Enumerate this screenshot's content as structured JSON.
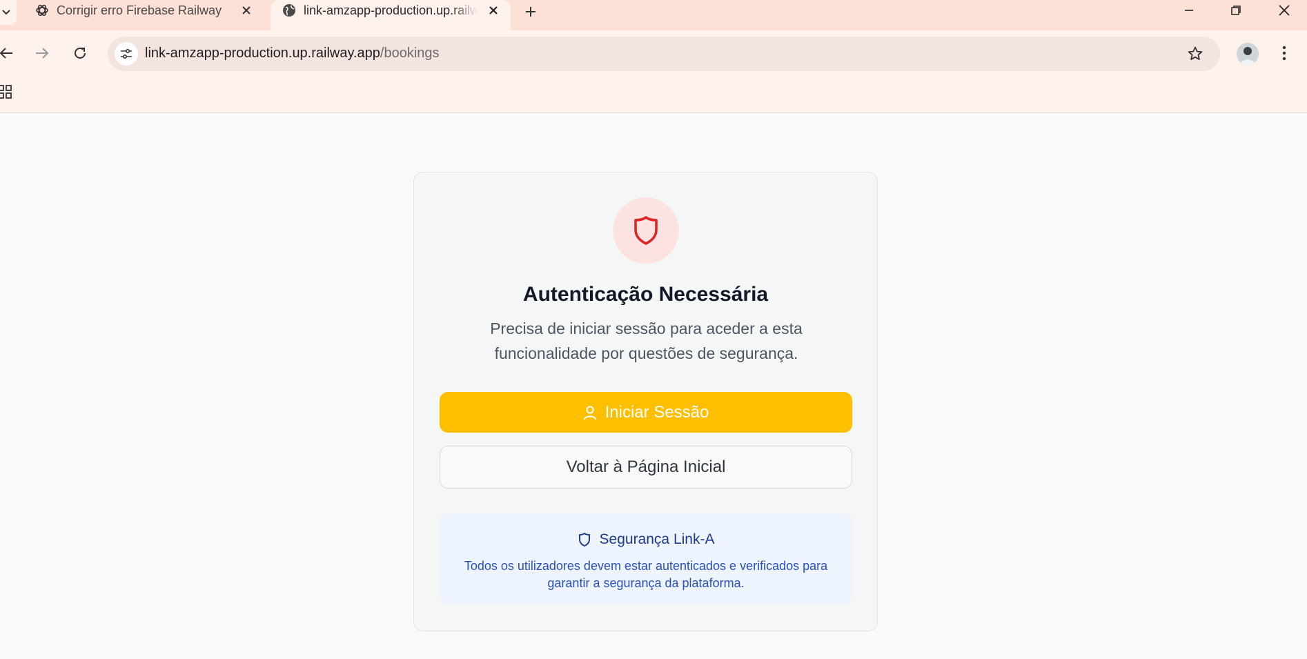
{
  "browser": {
    "tabs": [
      {
        "title": "Corrigir erro Firebase Railway",
        "favicon": "chatgpt-icon",
        "active": false
      },
      {
        "title": "link-amzapp-production.up.railway.app/bookings",
        "favicon": "globe-icon",
        "active": true
      }
    ],
    "address": {
      "host": "link-amzapp-production.up.railway.app",
      "path": "/bookings"
    }
  },
  "auth_card": {
    "title": "Autenticação Necessária",
    "description": "Precisa de iniciar sessão para aceder a esta funcionalidade por questões de segurança.",
    "login_button": "Iniciar Sessão",
    "home_button": "Voltar à Página Inicial",
    "security": {
      "heading": "Segurança Link-A",
      "text": "Todos os utilizadores devem estar autenticados e verificados para garantir a segurança da plataforma."
    }
  },
  "colors": {
    "primary_button": "#fdbf00",
    "shield_red": "#dc2626",
    "shield_bg": "#fde2e2",
    "info_bg": "#eef4fd",
    "info_text": "#2a4fb8"
  }
}
